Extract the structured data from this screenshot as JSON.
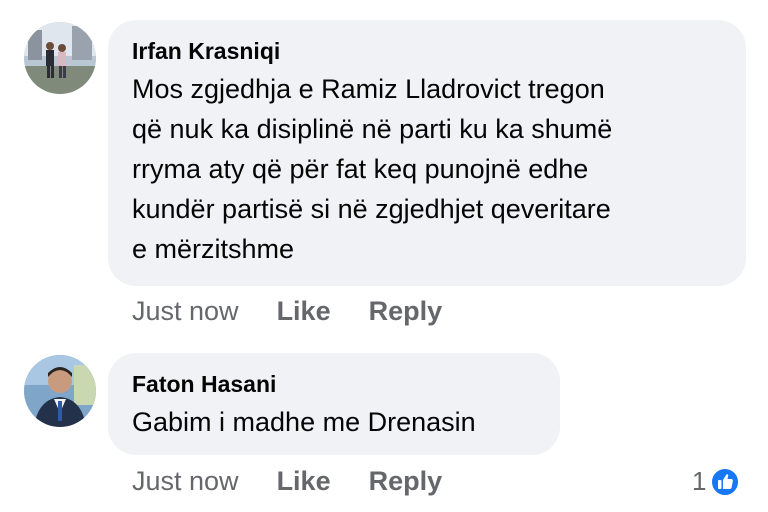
{
  "comments": [
    {
      "author": "Irfan Krasniqi",
      "text": "Mos zgjedhja e Ramiz Lladrovict tregon\nqë nuk ka disiplinë në parti ku ka shumë\nrryma aty që për fat keq punojnë edhe\nkundër partisë si në zgjedhjet qeveritare\ne mërzitshme",
      "time": "Just now",
      "like_label": "Like",
      "reply_label": "Reply"
    },
    {
      "author": "Faton Hasani",
      "text": "Gabim i madhe me Drenasin",
      "time": "Just now",
      "like_label": "Like",
      "reply_label": "Reply",
      "reaction_count": "1",
      "reaction_icon": "like-thumbs-up-icon"
    }
  ],
  "colors": {
    "bubble": "#f0f2f5",
    "text": "#050505",
    "meta": "#65676b",
    "like_blue": "#1877f2"
  }
}
